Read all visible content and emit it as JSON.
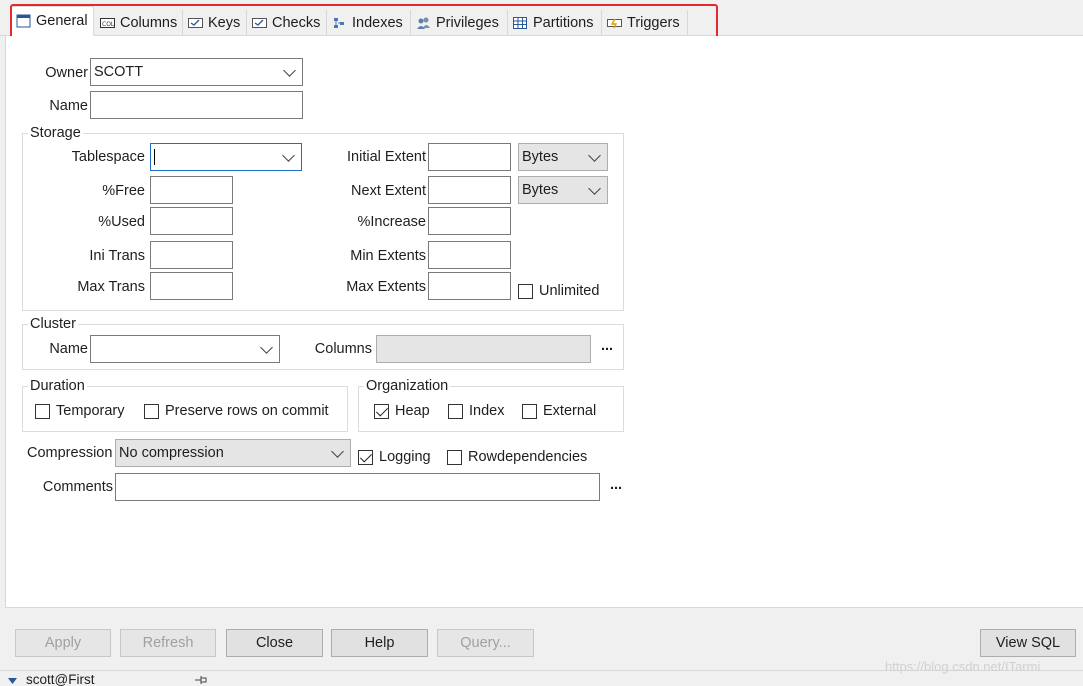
{
  "tabs": [
    {
      "label": "General",
      "icon": "window-icon",
      "active": true
    },
    {
      "label": "Columns",
      "icon": "columns-icon"
    },
    {
      "label": "Keys",
      "icon": "key-icon"
    },
    {
      "label": "Checks",
      "icon": "check-icon"
    },
    {
      "label": "Indexes",
      "icon": "index-icon"
    },
    {
      "label": "Privileges",
      "icon": "users-icon"
    },
    {
      "label": "Partitions",
      "icon": "table-grid-icon"
    },
    {
      "label": "Triggers",
      "icon": "trigger-icon"
    }
  ],
  "highlight_color": "#e5292f",
  "general": {
    "owner_label": "Owner",
    "owner_value": "SCOTT",
    "name_label": "Name",
    "name_value": ""
  },
  "storage": {
    "title": "Storage",
    "tablespace_label": "Tablespace",
    "tablespace_value": "",
    "free_label": "%Free",
    "used_label": "%Used",
    "ini_trans_label": "Ini Trans",
    "max_trans_label": "Max Trans",
    "initial_extent_label": "Initial Extent",
    "initial_extent_unit": "Bytes",
    "next_extent_label": "Next Extent",
    "next_extent_unit": "Bytes",
    "increase_label": "%Increase",
    "min_extents_label": "Min Extents",
    "max_extents_label": "Max Extents",
    "unlimited_label": "Unlimited"
  },
  "cluster": {
    "title": "Cluster",
    "name_label": "Name",
    "columns_label": "Columns",
    "more": "..."
  },
  "duration": {
    "title": "Duration",
    "temporary_label": "Temporary",
    "preserve_label": "Preserve rows on commit"
  },
  "organization": {
    "title": "Organization",
    "heap_label": "Heap",
    "index_label": "Index",
    "external_label": "External"
  },
  "compression": {
    "label": "Compression",
    "value": "No compression",
    "logging_label": "Logging",
    "rowdep_label": "Rowdependencies"
  },
  "comments": {
    "label": "Comments",
    "more": "..."
  },
  "buttons": {
    "apply": "Apply",
    "refresh": "Refresh",
    "close": "Close",
    "help": "Help",
    "query": "Query...",
    "view_sql": "View SQL"
  },
  "status": {
    "connection": "scott@First"
  },
  "watermark": "https://blog.csdn.net/ITarmi"
}
